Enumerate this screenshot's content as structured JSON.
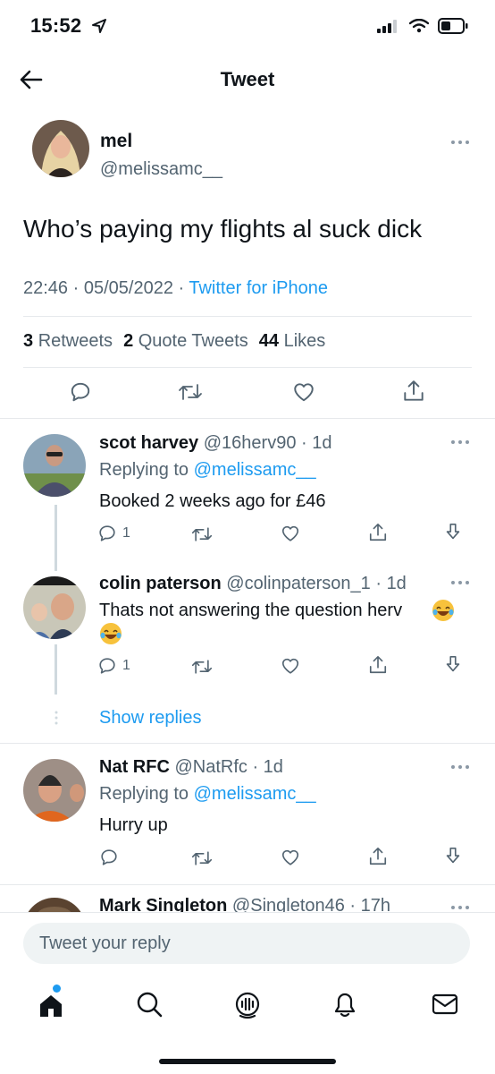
{
  "status": {
    "time": "15:52"
  },
  "header": {
    "title": "Tweet"
  },
  "tweet": {
    "name": "mel",
    "handle": "@melissamc__",
    "text": "Who’s paying my flights al suck dick",
    "time": "22:46",
    "date": "05/05/2022",
    "source": "Twitter for iPhone",
    "retweets": "3",
    "retweets_label": "Retweets",
    "quotes": "2",
    "quotes_label": "Quote Tweets",
    "likes": "44",
    "likes_label": "Likes"
  },
  "replies": [
    {
      "name": "scot harvey",
      "handle": "@16herv90",
      "age": "1d",
      "replying_prefix": "Replying to",
      "replying_to": "@melissamc__",
      "text": "Booked 2 weeks ago for £46",
      "reply_count": "1"
    },
    {
      "name": "colin paterson",
      "handle": "@colinpaterson_1",
      "age": "1d",
      "text": "Thats not answering the question herv",
      "reply_count": "1"
    },
    {
      "name": "Nat RFC",
      "handle": "@NatRfc",
      "age": "1d",
      "replying_prefix": "Replying to",
      "replying_to": "@melissamc__",
      "text": "Hurry up"
    },
    {
      "name": "Mark Singleton",
      "handle": "@Singleton46",
      "age": "17h"
    }
  ],
  "show_replies_label": "Show replies",
  "reply_box": {
    "placeholder": "Tweet your reply"
  },
  "icons": {
    "back": "arrow-left-icon",
    "more": "more-dots-icon",
    "reply": "comment-icon",
    "retweet": "retweet-icon",
    "like": "heart-icon",
    "share": "share-icon",
    "download": "download-icon",
    "home": "home-icon",
    "search": "search-icon",
    "spaces": "spaces-icon",
    "notifications": "bell-icon",
    "messages": "mail-icon"
  },
  "colors": {
    "accent": "#1d9bf0",
    "secondary_text": "#536471",
    "notification_dot": "#1d9bf0"
  }
}
